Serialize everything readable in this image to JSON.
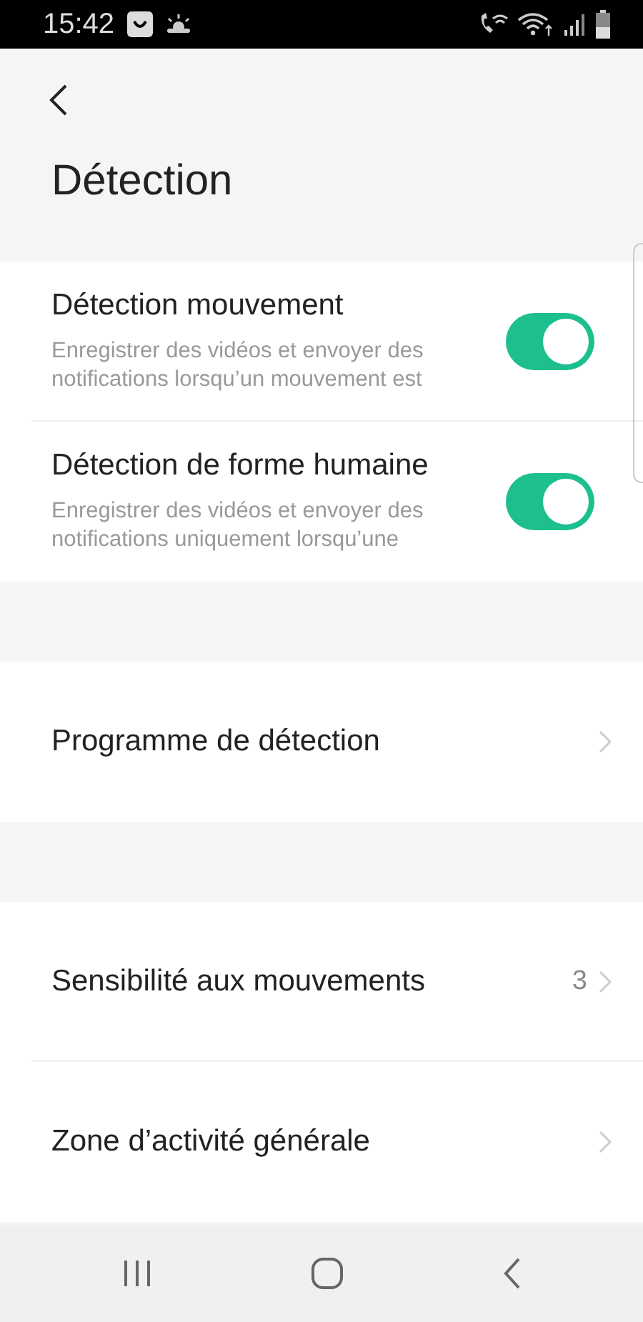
{
  "status_bar": {
    "time": "15:42"
  },
  "title": "Détection",
  "sections": [
    {
      "items": [
        {
          "kind": "toggle",
          "label": "Détection mouvement",
          "description": "Enregistrer des vidéos et envoyer des notifications lorsqu’un mouvement est",
          "on": true
        },
        {
          "kind": "toggle",
          "label": "Détection de forme humaine",
          "description": "Enregistrer des vidéos et envoyer des notifications uniquement lorsqu’une",
          "on": true
        }
      ]
    },
    {
      "items": [
        {
          "kind": "link",
          "label": "Programme de détection"
        }
      ]
    },
    {
      "items": [
        {
          "kind": "link",
          "label": "Sensibilité aux mouvements",
          "value": "3"
        },
        {
          "kind": "link",
          "label": "Zone d’activité générale"
        }
      ]
    }
  ]
}
